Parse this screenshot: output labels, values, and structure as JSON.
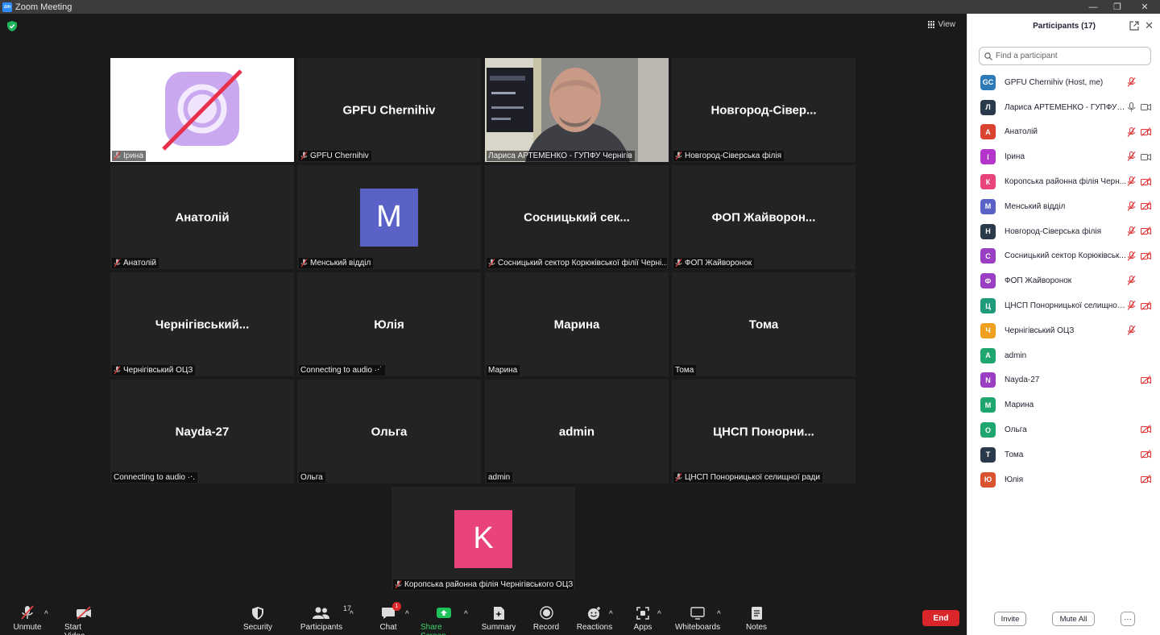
{
  "window": {
    "title": "Zoom Meeting",
    "logo_text": "zm",
    "min": "—",
    "restore": "❐",
    "close": "✕"
  },
  "view_button": {
    "label": "View"
  },
  "tiles": [
    {
      "label": "Ірина",
      "mic_off": true
    },
    {
      "big": "GPFU Chernihiv",
      "label": "GPFU Chernihiv",
      "mic_off": true
    },
    {
      "label": "Лариса АРТЕМЕНКО - ГУПФУ Чернігів",
      "mic_off": false,
      "speaker": true
    },
    {
      "big": "Новгород-Сівер...",
      "label": "Новгород-Сіверська філія",
      "mic_off": true
    },
    {
      "big": "Анатолій",
      "label": "Анатолій",
      "mic_off": true
    },
    {
      "avatar": "M",
      "avatar_color": "#5a62c8",
      "label": "Менський відділ",
      "mic_off": true
    },
    {
      "big": "Сосницький  сек...",
      "label": "Сосницький сектор Корюківської філії Черні...",
      "mic_off": true
    },
    {
      "big": "ФОП  Жайворон...",
      "label": "ФОП Жайворонок",
      "mic_off": true
    },
    {
      "big": "Чернігівський...",
      "label": "Чернігівський ОЦЗ",
      "mic_off": true
    },
    {
      "big": "Юлія",
      "label": "Connecting to audio ·‧˙",
      "mic_off": false
    },
    {
      "big": "Марина",
      "label": "Марина",
      "mic_off": false
    },
    {
      "big": "Тома",
      "label": "Тома",
      "mic_off": false
    },
    {
      "big": "Nayda-27",
      "label": "Connecting to audio ·‧.",
      "mic_off": false
    },
    {
      "big": "Ольга",
      "label": "Ольга",
      "mic_off": false
    },
    {
      "big": "admin",
      "label": "admin",
      "mic_off": false
    },
    {
      "big": "ЦНСП  Понорни...",
      "label": "ЦНСП Понорницької селищної ради",
      "mic_off": true
    },
    {
      "avatar": "K",
      "avatar_color": "#e8437a",
      "label": "Коропська районна філія Чернігівського ОЦЗ",
      "mic_off": true
    }
  ],
  "toolbar": {
    "unmute": "Unmute",
    "start_video": "Start Video",
    "security": "Security",
    "participants": "Participants",
    "participants_count": "17",
    "chat": "Chat",
    "chat_badge": "1",
    "share_screen": "Share Screen",
    "summary": "Summary",
    "record": "Record",
    "reactions": "Reactions",
    "apps": "Apps",
    "whiteboards": "Whiteboards",
    "notes": "Notes",
    "end": "End",
    "caret": "^"
  },
  "panel": {
    "title": "Participants (17)",
    "close": "✕",
    "search_placeholder": "Find a participant",
    "participants": [
      {
        "initials": "GC",
        "color": "#2d7ab8",
        "name": "GPFU Chernihiv (Host, me)",
        "mic": "off",
        "video": "none"
      },
      {
        "initials": "Л",
        "color": "#2b3a4a",
        "name": "Лариса АРТЕМЕНКО - ГУПФУ Ч...",
        "mic": "on",
        "video": "on"
      },
      {
        "initials": "А",
        "color": "#d9432f",
        "name": "Анатолій",
        "mic": "off",
        "video": "off"
      },
      {
        "initials": "І",
        "color": "#b534c9",
        "name": "Ірина",
        "mic": "off",
        "video": "on"
      },
      {
        "initials": "К",
        "color": "#e8437a",
        "name": "Коропська районна філія Черн...",
        "mic": "off",
        "video": "off"
      },
      {
        "initials": "М",
        "color": "#5a62c8",
        "name": "Менський відділ",
        "mic": "off",
        "video": "off"
      },
      {
        "initials": "Н",
        "color": "#2b3a4a",
        "name": "Новгород-Сіверська філія",
        "mic": "off",
        "video": "off"
      },
      {
        "initials": "С",
        "color": "#9a3fc4",
        "name": "Сосницький сектор Корюківськ...",
        "mic": "off",
        "video": "off"
      },
      {
        "initials": "Ф",
        "color": "#9a3fc4",
        "name": "ФОП Жайворонок",
        "mic": "off",
        "video": "none"
      },
      {
        "initials": "Ц",
        "color": "#1f9a7a",
        "name": "ЦНСП Понорницької селищної ...",
        "mic": "off",
        "video": "off"
      },
      {
        "initials": "Ч",
        "color": "#f0a020",
        "name": "Чернігівський ОЦЗ",
        "mic": "off",
        "video": "none"
      },
      {
        "initials": "A",
        "color": "#1fa56e",
        "name": "admin",
        "mic": "none",
        "video": "none"
      },
      {
        "initials": "N",
        "color": "#9a3fc4",
        "name": "Nayda-27",
        "mic": "none",
        "video": "off"
      },
      {
        "initials": "М",
        "color": "#1fa56e",
        "name": "Марина",
        "mic": "none",
        "video": "none"
      },
      {
        "initials": "О",
        "color": "#1fa56e",
        "name": "Ольга",
        "mic": "none",
        "video": "off"
      },
      {
        "initials": "Т",
        "color": "#2b3a4a",
        "name": "Тома",
        "mic": "none",
        "video": "off"
      },
      {
        "initials": "Ю",
        "color": "#d9532f",
        "name": "Юлія",
        "mic": "none",
        "video": "off"
      }
    ],
    "invite": "Invite",
    "mute_all": "Mute All",
    "more": "···"
  }
}
